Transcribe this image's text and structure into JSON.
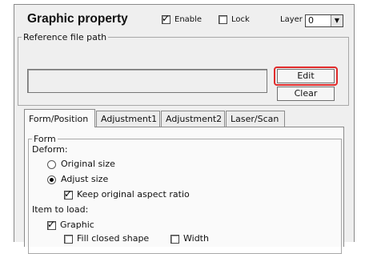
{
  "header": {
    "title": "Graphic property",
    "enable_label": "Enable",
    "enable_checked": true,
    "lock_label": "Lock",
    "lock_checked": false,
    "layer_label": "Layer",
    "layer_value": "0"
  },
  "reference": {
    "legend": "Reference file path",
    "path_value": "",
    "edit_label": "Edit",
    "clear_label": "Clear"
  },
  "tabs": [
    {
      "label": "Form/Position",
      "active": true
    },
    {
      "label": "Adjustment1",
      "active": false
    },
    {
      "label": "Adjustment2",
      "active": false
    },
    {
      "label": "Laser/Scan",
      "active": false
    }
  ],
  "form": {
    "legend": "Form",
    "deform_label": "Deform:",
    "original_size_label": "Original size",
    "adjust_size_label": "Adjust size",
    "selected_deform": "Adjust size",
    "keep_ratio_label": "Keep original aspect ratio",
    "keep_ratio_checked": true,
    "item_to_load_label": "Item to load:",
    "graphic_label": "Graphic",
    "graphic_checked": true,
    "fill_closed_label": "Fill closed shape",
    "fill_closed_checked": false,
    "width_label": "Width",
    "width_checked": false
  },
  "colors": {
    "highlight": "#e02a2a",
    "panel_bg": "#efefef"
  }
}
